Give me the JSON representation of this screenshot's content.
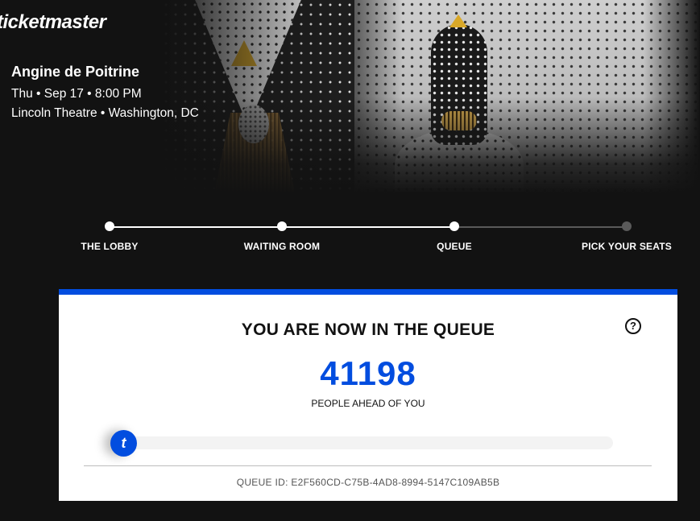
{
  "brand": {
    "logo_text": "ticketmaster",
    "accent": "#024ddf"
  },
  "event": {
    "title": "Angine de Poitrine",
    "date_line": "Thu • Sep 17 • 8:00 PM",
    "venue_line": "Lincoln Theatre • Washington, DC"
  },
  "steps": [
    {
      "label": "THE LOBBY",
      "status": "complete"
    },
    {
      "label": "WAITING ROOM",
      "status": "complete"
    },
    {
      "label": "QUEUE",
      "status": "current"
    },
    {
      "label": "PICK YOUR SEATS",
      "status": "upcoming"
    }
  ],
  "queue": {
    "title": "YOU ARE NOW IN THE QUEUE",
    "help_icon": "question-circle-icon",
    "help_glyph": "?",
    "count": "41198",
    "count_label": "PEOPLE AHEAD OF YOU",
    "progress_fraction": 0.02,
    "progress_icon_letter": "t",
    "queue_id": "QUEUE ID: E2F560CD-C75B-4AD8-8994-5147C109AB5B"
  },
  "colors": {
    "background": "#121212",
    "step_complete": "#ffffff",
    "step_upcoming": "#5a5a5a"
  }
}
